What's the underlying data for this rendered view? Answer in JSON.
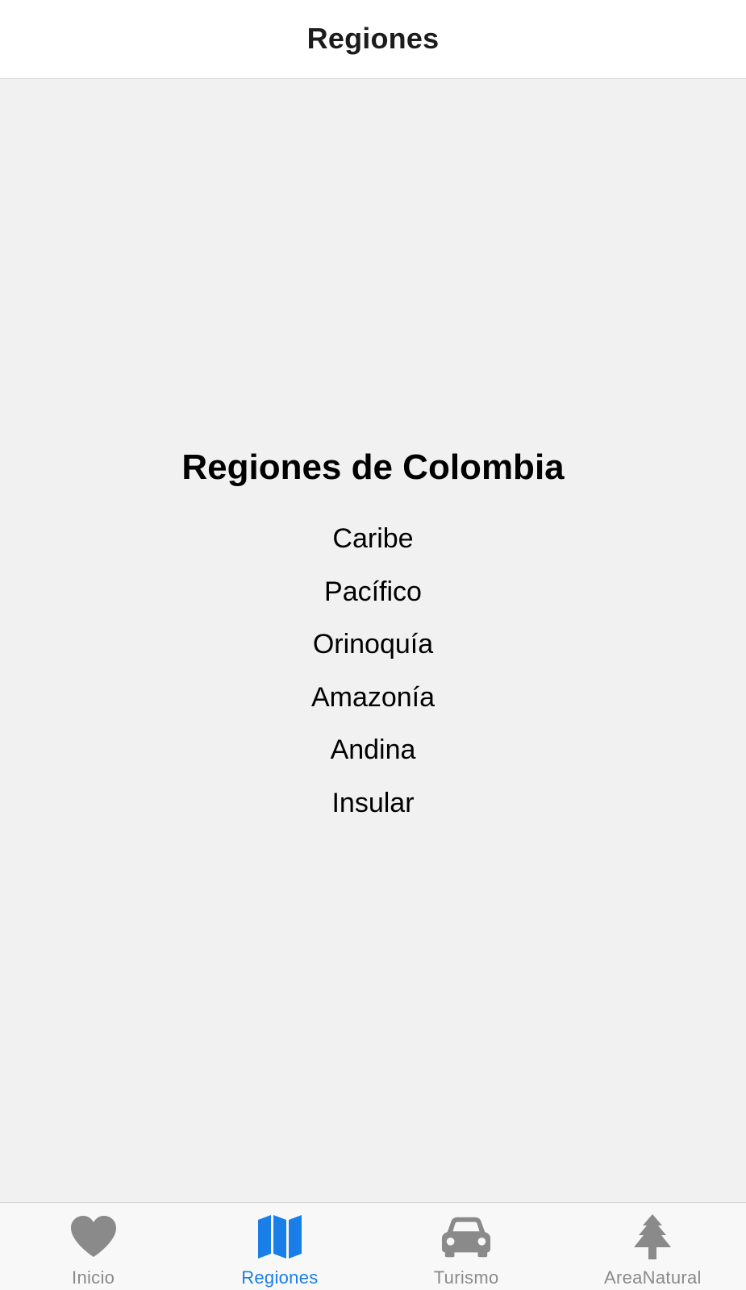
{
  "header": {
    "title": "Regiones"
  },
  "main": {
    "title": "Regiones de Colombia",
    "regions": [
      "Caribe",
      "Pacífico",
      "Orinoquía",
      "Amazonía",
      "Andina",
      "Insular"
    ]
  },
  "tabbar": {
    "tabs": [
      {
        "label": "Inicio",
        "icon": "heart-icon",
        "active": false
      },
      {
        "label": "Regiones",
        "icon": "map-icon",
        "active": true
      },
      {
        "label": "Turismo",
        "icon": "car-icon",
        "active": false
      },
      {
        "label": "AreaNatural",
        "icon": "tree-icon",
        "active": false
      }
    ]
  },
  "colors": {
    "active": "#1a7ee8",
    "inactive": "#8a8a8a",
    "background": "#f1f1f1",
    "header": "#ffffff"
  }
}
